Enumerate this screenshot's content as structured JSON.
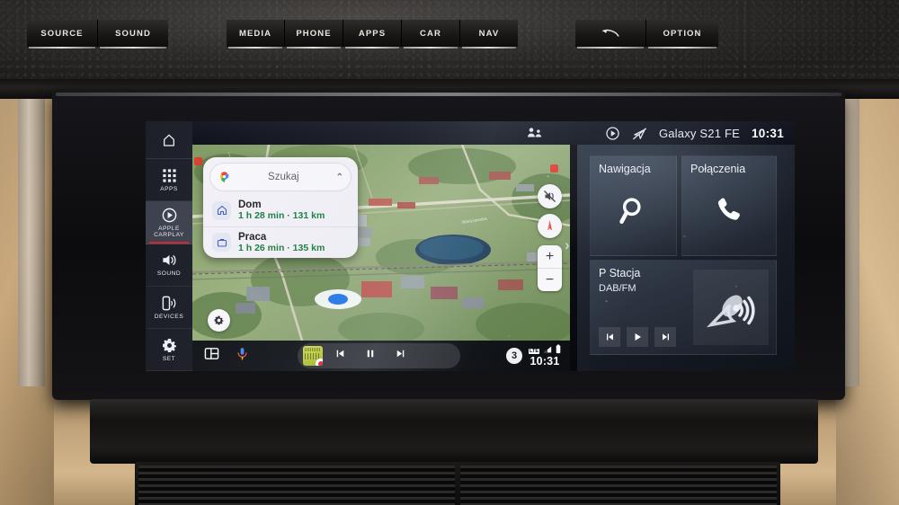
{
  "screen": {
    "statusbar": {
      "passenger_icon": "passenger-icon",
      "carplay_icon": "carplay-icon",
      "nav_off_icon": "navigation-off-icon",
      "device_name": "Galaxy S21 FE",
      "clock": "10:31"
    },
    "sidebar": {
      "home_icon": "home-icon",
      "items": [
        {
          "label": "APPS",
          "icon": "apps-grid-icon",
          "active": false
        },
        {
          "label": "APPLE CARPLAY",
          "icon": "carplay-circle-icon",
          "active": true
        },
        {
          "label": "SOUND",
          "icon": "speaker-icon",
          "active": false
        },
        {
          "label": "DEVICES",
          "icon": "devices-icon",
          "active": false
        },
        {
          "label": "SET",
          "icon": "gear-icon",
          "active": false
        }
      ],
      "active_accent": "#d0202c"
    },
    "carplay": {
      "expand_chevron": "›",
      "maps": {
        "search_placeholder": "Szukaj",
        "search_icon": "google-maps-pin-icon",
        "collapse_icon": "chevron-up-icon",
        "destinations": [
          {
            "name": "Dom",
            "detail": "1 h 28 min · 131 km",
            "icon": "home-icon"
          },
          {
            "name": "Praca",
            "detail": "1 h 26 min · 135 km",
            "icon": "briefcase-icon"
          }
        ],
        "controls": [
          {
            "name": "mute-icon"
          },
          {
            "name": "compass-north-icon"
          },
          {
            "name": "zoom-in-icon",
            "label": "+"
          },
          {
            "name": "zoom-out-icon",
            "label": "−"
          }
        ],
        "settings_icon": "gear-icon",
        "duration_color": "#157a3a"
      },
      "bottombar": {
        "dashboard_icon": "dashboard-icon",
        "assistant_icon": "google-assistant-mic-icon",
        "album_art": "album-art-thumbnail",
        "prev_icon": "previous-track-icon",
        "pause_icon": "pause-icon",
        "next_icon": "next-track-icon",
        "notification_count": "3",
        "network_label": "LTE",
        "signal_icon": "signal-bars-icon",
        "battery_icon": "battery-icon",
        "clock": "10:31"
      }
    },
    "tiles": [
      {
        "title": "Nawigacja",
        "subtitle": "",
        "icon": "magnifier-icon"
      },
      {
        "title": "Połączenia",
        "subtitle": "",
        "icon": "phone-handset-icon"
      },
      {
        "title": "P Stacja",
        "subtitle": "DAB/FM",
        "icon": "satellite-dish-icon",
        "controls": [
          {
            "name": "previous-station-icon"
          },
          {
            "name": "play-icon"
          },
          {
            "name": "next-station-icon"
          }
        ]
      }
    ]
  },
  "hardware": {
    "left_buttons": [
      "SOURCE",
      "SOUND"
    ],
    "middle_buttons": [
      "MEDIA",
      "PHONE",
      "APPS",
      "CAR",
      "NAV"
    ],
    "right_buttons": [
      "OPTION"
    ],
    "back_button_icon": "back-arrow-icon",
    "left_knob": "volume-knob",
    "right_knob": "tune-knob"
  }
}
